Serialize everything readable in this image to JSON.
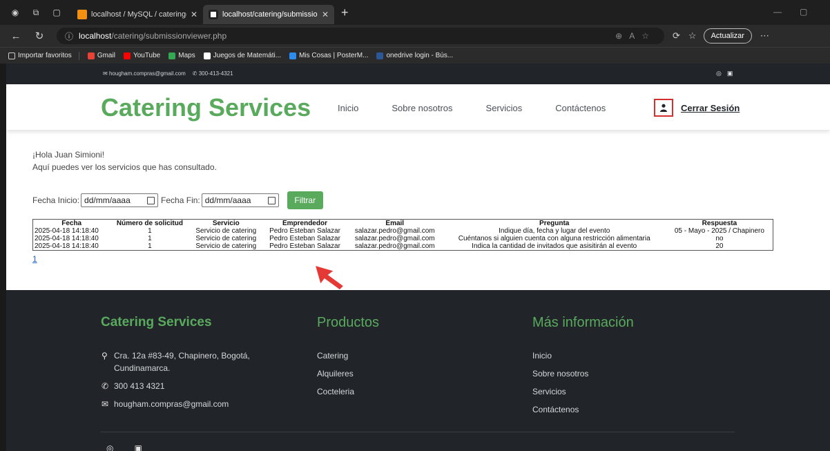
{
  "browser": {
    "tabs": [
      {
        "title": "localhost / MySQL / cateringdb /",
        "active": false
      },
      {
        "title": "localhost/catering/submissionvie",
        "active": true
      }
    ],
    "url_host": "localhost",
    "url_path": "/catering/submissionviewer.php",
    "update_label": "Actualizar",
    "bookmarks": [
      "Importar favoritos",
      "Gmail",
      "YouTube",
      "Maps",
      "Juegos de Matemáti...",
      "Mis Cosas | PosterM...",
      "onedrive login - Bús..."
    ]
  },
  "topbar": {
    "email": "hougham.compras@gmail.com",
    "phone": "300-413-4321"
  },
  "header": {
    "brand": "Catering Services",
    "nav": [
      "Inicio",
      "Sobre nosotros",
      "Servicios",
      "Contáctenos"
    ],
    "logout": "Cerrar Sesión"
  },
  "main": {
    "greeting": "¡Hola Juan Simioni!",
    "subtitle": "Aquí puedes ver los servicios que has consultado.",
    "filter": {
      "start_label": "Fecha Inicio:",
      "start_placeholder": "dd/mm/aaaa",
      "end_label": "Fecha Fin:",
      "end_placeholder": "dd/mm/aaaa",
      "button": "Filtrar"
    },
    "table": {
      "headers": [
        "Fecha",
        "Número de solicitud",
        "Servicio",
        "Emprendedor",
        "Email",
        "Pregunta",
        "Respuesta"
      ],
      "rows": [
        [
          "2025-04-18 14:18:40",
          "1",
          "Servicio de catering",
          "Pedro Esteban Salazar",
          "salazar.pedro@gmail.com",
          "Indique día, fecha y lugar del evento",
          "05 - Mayo - 2025 / Chapinero"
        ],
        [
          "2025-04-18 14:18:40",
          "1",
          "Servicio de catering",
          "Pedro Esteban Salazar",
          "salazar.pedro@gmail.com",
          "Cuéntanos si alguien cuenta con alguna restricción alimentaria",
          "no"
        ],
        [
          "2025-04-18 14:18:40",
          "1",
          "Servicio de catering",
          "Pedro Esteban Salazar",
          "salazar.pedro@gmail.com",
          "Indica la cantidad de invitados que asisitirán al evento",
          "20"
        ]
      ]
    },
    "pager": "1"
  },
  "footer": {
    "brand": "Catering Services",
    "address": "Cra. 12a #83-49, Chapinero, Bogotá, Cundinamarca.",
    "phone": "300 413 4321",
    "email": "hougham.compras@gmail.com",
    "products_title": "Productos",
    "products": [
      "Catering",
      "Alquileres",
      "Cocteleria"
    ],
    "more_title": "Más información",
    "more": [
      "Inicio",
      "Sobre nosotros",
      "Servicios",
      "Contáctenos"
    ]
  },
  "colors": {
    "brand_green": "#5aaa5e",
    "dark": "#212529",
    "highlight_red": "#d32f2f"
  }
}
